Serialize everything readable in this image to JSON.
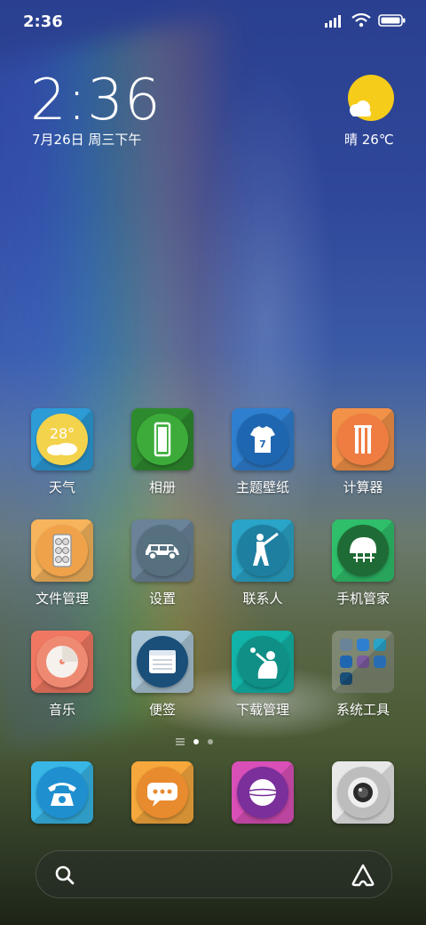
{
  "status_bar": {
    "time": "2:36",
    "icons": [
      "signal-icon",
      "wifi-icon",
      "battery-icon"
    ]
  },
  "widget": {
    "clock": "2:36",
    "date": "7月26日 周三下午",
    "weather": "晴 26℃",
    "weather_icon": "sun-cloud-icon"
  },
  "apps": [
    {
      "label": "天气",
      "icon": "weather-icon",
      "badge_text": "28°"
    },
    {
      "label": "相册",
      "icon": "gallery-icon"
    },
    {
      "label": "主题壁纸",
      "icon": "jersey-icon",
      "badge_text": "7"
    },
    {
      "label": "计算器",
      "icon": "wickets-icon"
    },
    {
      "label": "文件管理",
      "icon": "files-icon"
    },
    {
      "label": "设置",
      "icon": "car-icon"
    },
    {
      "label": "联系人",
      "icon": "batsman-icon"
    },
    {
      "label": "手机管家",
      "icon": "helmet-icon"
    },
    {
      "label": "音乐",
      "icon": "disc-icon"
    },
    {
      "label": "便签",
      "icon": "notes-icon"
    },
    {
      "label": "下载管理",
      "icon": "fielder-icon"
    },
    {
      "label": "系统工具",
      "icon": "folder-icon"
    }
  ],
  "dock": [
    {
      "name": "phone",
      "icon": "telephone-icon"
    },
    {
      "name": "messages",
      "icon": "chat-bubble-icon"
    },
    {
      "name": "browser",
      "icon": "ball-icon"
    },
    {
      "name": "camera",
      "icon": "camera-icon"
    }
  ],
  "page_indicator": {
    "pages": 2,
    "current": 1
  },
  "search": {
    "left_icon": "search-icon",
    "right_icon": "assistant-icon"
  }
}
